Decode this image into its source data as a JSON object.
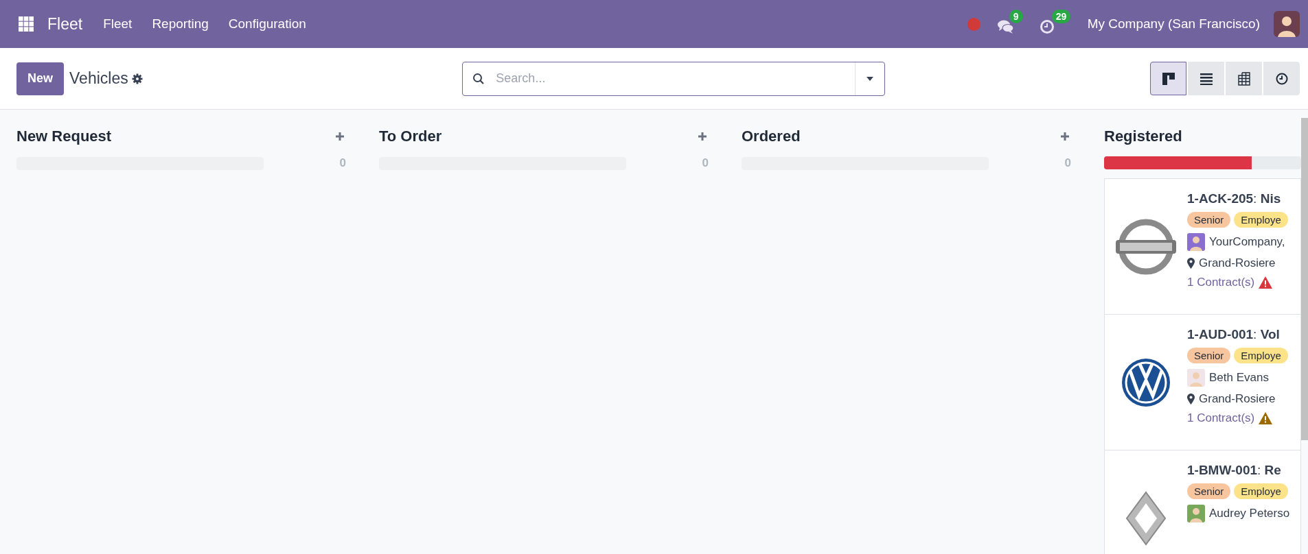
{
  "navbar": {
    "app_name": "Fleet",
    "menu": [
      "Fleet",
      "Reporting",
      "Configuration"
    ],
    "messages_badge": "9",
    "activities_badge": "29",
    "company": "My Company (San Francisco)"
  },
  "control_panel": {
    "new_button": "New",
    "title": "Vehicles",
    "search": {
      "placeholder": "Search..."
    },
    "views": [
      {
        "kind": "kanban",
        "selected": true
      },
      {
        "kind": "list",
        "selected": false
      },
      {
        "kind": "pivot",
        "selected": false
      },
      {
        "kind": "activity",
        "selected": false
      }
    ]
  },
  "columns": [
    {
      "title": "New Request",
      "count": "0"
    },
    {
      "title": "To Order",
      "count": "0"
    },
    {
      "title": "Ordered",
      "count": "0"
    },
    {
      "title": "Registered",
      "level": 0.75,
      "cards": [
        {
          "kind": "ring",
          "title": "**1-ACK-205**: **Nis**",
          "tags": [
            {
              "label": "Senior",
              "color": "#f8c69e"
            },
            {
              "label": "Employe",
              "color": "#fce38a"
            }
          ],
          "driver": "YourCompany,",
          "location": "Grand-Rosiere",
          "contracts": "1 Contract(s)",
          "color": "#d9363e"
        },
        {
          "kind": "circle",
          "title": "**1-AUD-001**: **Vol**",
          "tags": [
            {
              "label": "Senior",
              "color": "#f8c69e"
            },
            {
              "label": "Employe",
              "color": "#fce38a"
            }
          ],
          "driver": "Beth Evans",
          "location": "Grand-Rosiere",
          "contracts": "1 Contract(s)",
          "color": "#9c6a00"
        },
        {
          "kind": "diamond",
          "title": "**1-BMW-001**: **Re**",
          "tags": [
            {
              "label": "Senior",
              "color": "#f8c69e"
            },
            {
              "label": "Employe",
              "color": "#fce38a"
            }
          ],
          "driver": "Audrey Peterso"
        }
      ]
    }
  ]
}
